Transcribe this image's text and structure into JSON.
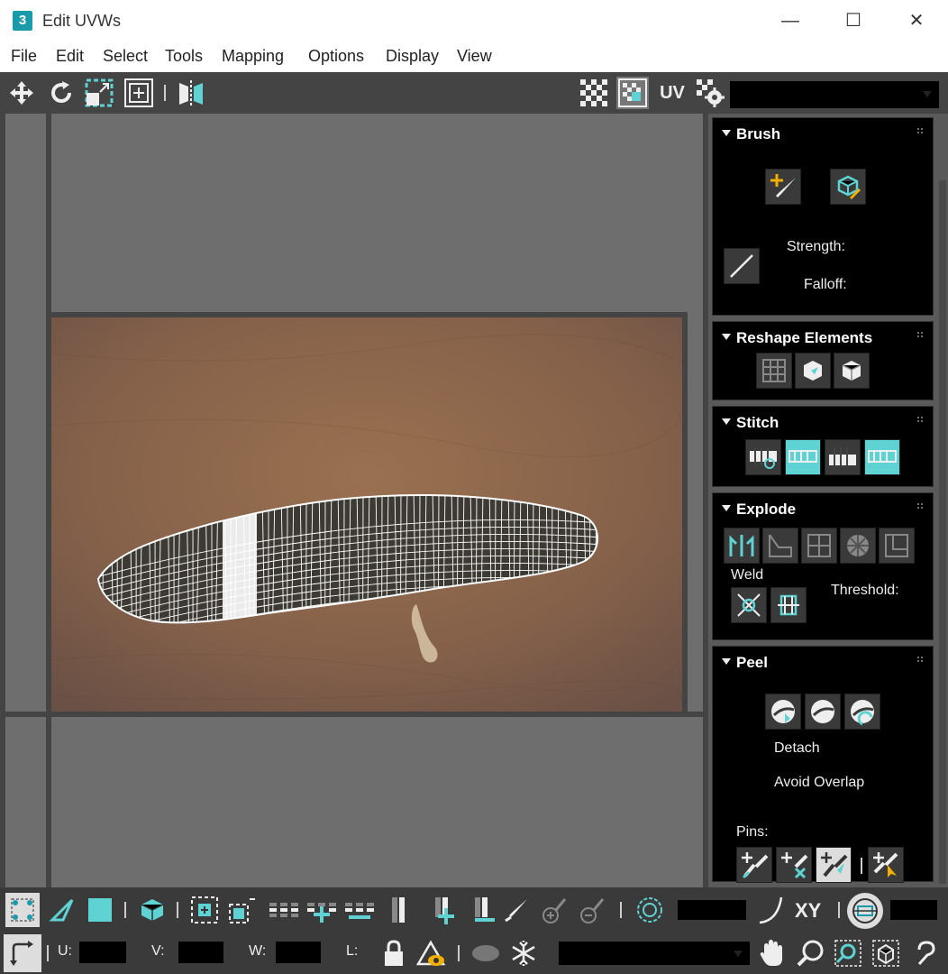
{
  "window": {
    "app_icon": "3",
    "title": "Edit UVWs",
    "minimize": "—",
    "maximize": "☐",
    "close": "✕"
  },
  "menu": [
    "File",
    "Edit",
    "Select",
    "Tools",
    "Mapping",
    "Options",
    "Display",
    "View"
  ],
  "toolbar": {
    "uv_label": "UV"
  },
  "panels": {
    "brush": {
      "title": "Brush",
      "strength_label": "Strength:",
      "falloff_label": "Falloff:"
    },
    "reshape": {
      "title": "Reshape Elements"
    },
    "stitch": {
      "title": "Stitch"
    },
    "explode": {
      "title": "Explode",
      "weld_label": "Weld",
      "threshold_label": "Threshold:"
    },
    "peel": {
      "title": "Peel",
      "detach_label": "Detach",
      "avoid_overlap_label": "Avoid Overlap",
      "pins_label": "Pins:"
    }
  },
  "bottom": {
    "xy_label": "XY",
    "u_label": "U:",
    "v_label": "V:",
    "w_label": "W:",
    "l_label": "L:"
  },
  "colors": {
    "accent": "#5fd3d3",
    "panel_bg": "#000000",
    "toolbar_bg": "#444444",
    "viewport_bg": "#6e6e6e",
    "texture_bg": "#8a6548"
  }
}
